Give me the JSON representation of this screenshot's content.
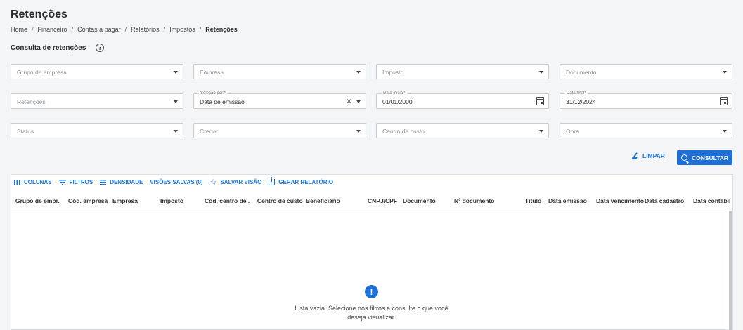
{
  "page": {
    "title": "Retenções",
    "breadcrumb": [
      "Home",
      "Financeiro",
      "Contas a pagar",
      "Relatórios",
      "Impostos",
      "Retenções"
    ],
    "section_title": "Consulta de retenções"
  },
  "filters": {
    "grupo_empresa": {
      "placeholder": "Grupo de empresa"
    },
    "empresa": {
      "placeholder": "Empresa"
    },
    "imposto": {
      "placeholder": "Imposto"
    },
    "documento": {
      "placeholder": "Documento"
    },
    "retencoes": {
      "placeholder": "Retenções"
    },
    "selecao_por": {
      "label": "Seleção por:*",
      "value": "Data de emissão"
    },
    "data_inicial": {
      "label": "Data inicial*",
      "value": "01/01/2000"
    },
    "data_final": {
      "label": "Data final*",
      "value": "31/12/2024"
    },
    "status": {
      "placeholder": "Status"
    },
    "credor": {
      "placeholder": "Credor"
    },
    "centro_custo": {
      "placeholder": "Centro de custo"
    },
    "obra": {
      "placeholder": "Obra"
    }
  },
  "actions": {
    "limpar": "LIMPAR",
    "consultar": "CONSULTAR"
  },
  "toolbar": {
    "colunas": "COLUNAS",
    "filtros": "FILTROS",
    "densidade": "DENSIDADE",
    "visoes_salvas": "VISÕES SALVAS (0)",
    "salvar_visao": "SALVAR VISÃO",
    "gerar_relatorio": "GERAR RELATÓRIO"
  },
  "table": {
    "columns": [
      "Grupo de empr...",
      "Cód. empresa",
      "Empresa",
      "Imposto",
      "Cód. centro de ...",
      "Centro de custo",
      "Beneficiário",
      "CNPJ/CPF",
      "Documento",
      "Nº documento",
      "Título",
      "Data emissão",
      "Data vencimento",
      "Data cadastro",
      "Data contábil"
    ],
    "empty_message": "Lista vazia. Selecione nos filtros e consulte o que você deseja visualizar."
  },
  "colors": {
    "accent": "#1f6fd6",
    "background": "#f4f5f7"
  }
}
